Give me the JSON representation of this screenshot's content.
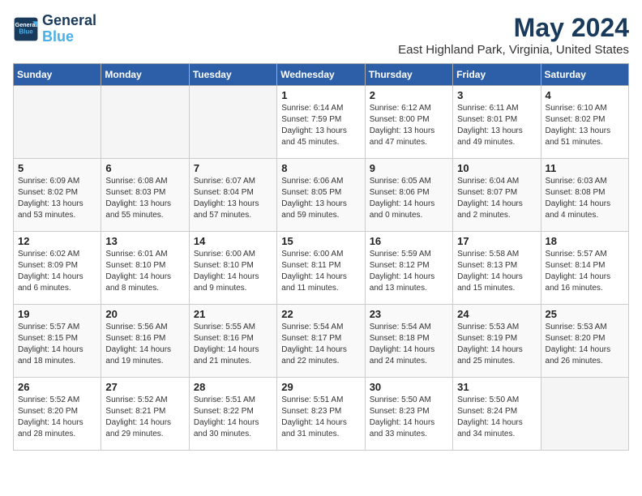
{
  "logo": {
    "line1": "General",
    "line2": "Blue"
  },
  "title": "May 2024",
  "location": "East Highland Park, Virginia, United States",
  "weekdays": [
    "Sunday",
    "Monday",
    "Tuesday",
    "Wednesday",
    "Thursday",
    "Friday",
    "Saturday"
  ],
  "weeks": [
    [
      {
        "day": "",
        "info": ""
      },
      {
        "day": "",
        "info": ""
      },
      {
        "day": "",
        "info": ""
      },
      {
        "day": "1",
        "info": "Sunrise: 6:14 AM\nSunset: 7:59 PM\nDaylight: 13 hours\nand 45 minutes."
      },
      {
        "day": "2",
        "info": "Sunrise: 6:12 AM\nSunset: 8:00 PM\nDaylight: 13 hours\nand 47 minutes."
      },
      {
        "day": "3",
        "info": "Sunrise: 6:11 AM\nSunset: 8:01 PM\nDaylight: 13 hours\nand 49 minutes."
      },
      {
        "day": "4",
        "info": "Sunrise: 6:10 AM\nSunset: 8:02 PM\nDaylight: 13 hours\nand 51 minutes."
      }
    ],
    [
      {
        "day": "5",
        "info": "Sunrise: 6:09 AM\nSunset: 8:02 PM\nDaylight: 13 hours\nand 53 minutes."
      },
      {
        "day": "6",
        "info": "Sunrise: 6:08 AM\nSunset: 8:03 PM\nDaylight: 13 hours\nand 55 minutes."
      },
      {
        "day": "7",
        "info": "Sunrise: 6:07 AM\nSunset: 8:04 PM\nDaylight: 13 hours\nand 57 minutes."
      },
      {
        "day": "8",
        "info": "Sunrise: 6:06 AM\nSunset: 8:05 PM\nDaylight: 13 hours\nand 59 minutes."
      },
      {
        "day": "9",
        "info": "Sunrise: 6:05 AM\nSunset: 8:06 PM\nDaylight: 14 hours\nand 0 minutes."
      },
      {
        "day": "10",
        "info": "Sunrise: 6:04 AM\nSunset: 8:07 PM\nDaylight: 14 hours\nand 2 minutes."
      },
      {
        "day": "11",
        "info": "Sunrise: 6:03 AM\nSunset: 8:08 PM\nDaylight: 14 hours\nand 4 minutes."
      }
    ],
    [
      {
        "day": "12",
        "info": "Sunrise: 6:02 AM\nSunset: 8:09 PM\nDaylight: 14 hours\nand 6 minutes."
      },
      {
        "day": "13",
        "info": "Sunrise: 6:01 AM\nSunset: 8:10 PM\nDaylight: 14 hours\nand 8 minutes."
      },
      {
        "day": "14",
        "info": "Sunrise: 6:00 AM\nSunset: 8:10 PM\nDaylight: 14 hours\nand 9 minutes."
      },
      {
        "day": "15",
        "info": "Sunrise: 6:00 AM\nSunset: 8:11 PM\nDaylight: 14 hours\nand 11 minutes."
      },
      {
        "day": "16",
        "info": "Sunrise: 5:59 AM\nSunset: 8:12 PM\nDaylight: 14 hours\nand 13 minutes."
      },
      {
        "day": "17",
        "info": "Sunrise: 5:58 AM\nSunset: 8:13 PM\nDaylight: 14 hours\nand 15 minutes."
      },
      {
        "day": "18",
        "info": "Sunrise: 5:57 AM\nSunset: 8:14 PM\nDaylight: 14 hours\nand 16 minutes."
      }
    ],
    [
      {
        "day": "19",
        "info": "Sunrise: 5:57 AM\nSunset: 8:15 PM\nDaylight: 14 hours\nand 18 minutes."
      },
      {
        "day": "20",
        "info": "Sunrise: 5:56 AM\nSunset: 8:16 PM\nDaylight: 14 hours\nand 19 minutes."
      },
      {
        "day": "21",
        "info": "Sunrise: 5:55 AM\nSunset: 8:16 PM\nDaylight: 14 hours\nand 21 minutes."
      },
      {
        "day": "22",
        "info": "Sunrise: 5:54 AM\nSunset: 8:17 PM\nDaylight: 14 hours\nand 22 minutes."
      },
      {
        "day": "23",
        "info": "Sunrise: 5:54 AM\nSunset: 8:18 PM\nDaylight: 14 hours\nand 24 minutes."
      },
      {
        "day": "24",
        "info": "Sunrise: 5:53 AM\nSunset: 8:19 PM\nDaylight: 14 hours\nand 25 minutes."
      },
      {
        "day": "25",
        "info": "Sunrise: 5:53 AM\nSunset: 8:20 PM\nDaylight: 14 hours\nand 26 minutes."
      }
    ],
    [
      {
        "day": "26",
        "info": "Sunrise: 5:52 AM\nSunset: 8:20 PM\nDaylight: 14 hours\nand 28 minutes."
      },
      {
        "day": "27",
        "info": "Sunrise: 5:52 AM\nSunset: 8:21 PM\nDaylight: 14 hours\nand 29 minutes."
      },
      {
        "day": "28",
        "info": "Sunrise: 5:51 AM\nSunset: 8:22 PM\nDaylight: 14 hours\nand 30 minutes."
      },
      {
        "day": "29",
        "info": "Sunrise: 5:51 AM\nSunset: 8:23 PM\nDaylight: 14 hours\nand 31 minutes."
      },
      {
        "day": "30",
        "info": "Sunrise: 5:50 AM\nSunset: 8:23 PM\nDaylight: 14 hours\nand 33 minutes."
      },
      {
        "day": "31",
        "info": "Sunrise: 5:50 AM\nSunset: 8:24 PM\nDaylight: 14 hours\nand 34 minutes."
      },
      {
        "day": "",
        "info": ""
      }
    ]
  ]
}
